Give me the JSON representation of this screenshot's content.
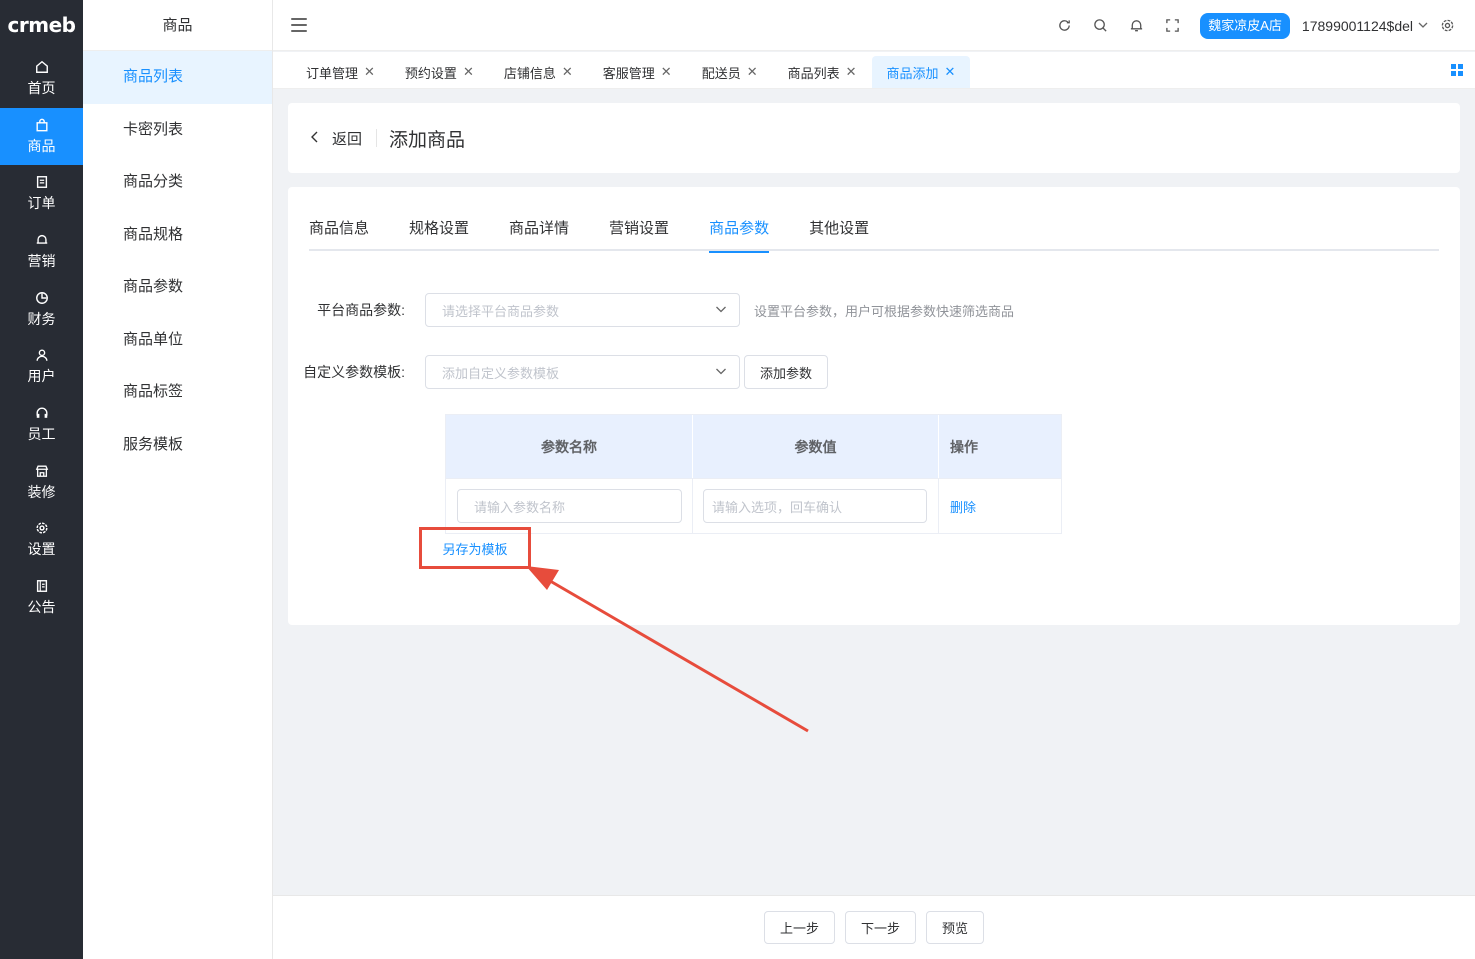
{
  "brand": {
    "logo_text": "crmeb",
    "accent": "#1890ff",
    "dark_nav": "#282c34",
    "highlight": "#e74c3c"
  },
  "nav": {
    "items": [
      {
        "label": "首页",
        "icon": "home-icon",
        "active": false
      },
      {
        "label": "商品",
        "icon": "bag-icon",
        "active": true
      },
      {
        "label": "订单",
        "icon": "document-icon",
        "active": false
      },
      {
        "label": "营销",
        "icon": "bell-icon",
        "active": false
      },
      {
        "label": "财务",
        "icon": "pie-icon",
        "active": false
      },
      {
        "label": "用户",
        "icon": "user-icon",
        "active": false
      },
      {
        "label": "员工",
        "icon": "headset-icon",
        "active": false
      },
      {
        "label": "装修",
        "icon": "store-icon",
        "active": false
      },
      {
        "label": "设置",
        "icon": "gear-icon",
        "active": false
      },
      {
        "label": "公告",
        "icon": "notice-icon",
        "active": false
      }
    ]
  },
  "subnav": {
    "title": "商品",
    "items": [
      {
        "label": "商品列表",
        "active": true
      },
      {
        "label": "卡密列表",
        "active": false
      },
      {
        "label": "商品分类",
        "active": false
      },
      {
        "label": "商品规格",
        "active": false
      },
      {
        "label": "商品参数",
        "active": false
      },
      {
        "label": "商品单位",
        "active": false
      },
      {
        "label": "商品标签",
        "active": false
      },
      {
        "label": "服务模板",
        "active": false
      }
    ]
  },
  "header": {
    "store": "魏家凉皮A店",
    "user": "17899001124$del"
  },
  "tabs": [
    {
      "label": "订单管理",
      "active": false
    },
    {
      "label": "预约设置",
      "active": false
    },
    {
      "label": "店铺信息",
      "active": false
    },
    {
      "label": "客服管理",
      "active": false
    },
    {
      "label": "配送员",
      "active": false
    },
    {
      "label": "商品列表",
      "active": false
    },
    {
      "label": "商品添加",
      "active": true
    }
  ],
  "page": {
    "back_label": "返回",
    "title": "添加商品"
  },
  "product_tabs": [
    {
      "label": "商品信息",
      "active": false
    },
    {
      "label": "规格设置",
      "active": false
    },
    {
      "label": "商品详情",
      "active": false
    },
    {
      "label": "营销设置",
      "active": false
    },
    {
      "label": "商品参数",
      "active": true
    },
    {
      "label": "其他设置",
      "active": false
    }
  ],
  "form": {
    "platform_label": "平台商品参数:",
    "platform_placeholder": "请选择平台商品参数",
    "platform_hint": "设置平台参数，用户可根据参数快速筛选商品",
    "custom_label": "自定义参数模板:",
    "custom_placeholder": "添加自定义参数模板",
    "add_param_button": "添加参数"
  },
  "param_table": {
    "headers": [
      "参数名称",
      "参数值",
      "操作"
    ],
    "rows": [
      {
        "name_placeholder": "请输入参数名称",
        "value_placeholder": "请输入选项，回车确认",
        "action": "删除"
      }
    ]
  },
  "save_template_link": "另存为模板",
  "footer": {
    "prev": "上一步",
    "next": "下一步",
    "preview": "预览"
  }
}
